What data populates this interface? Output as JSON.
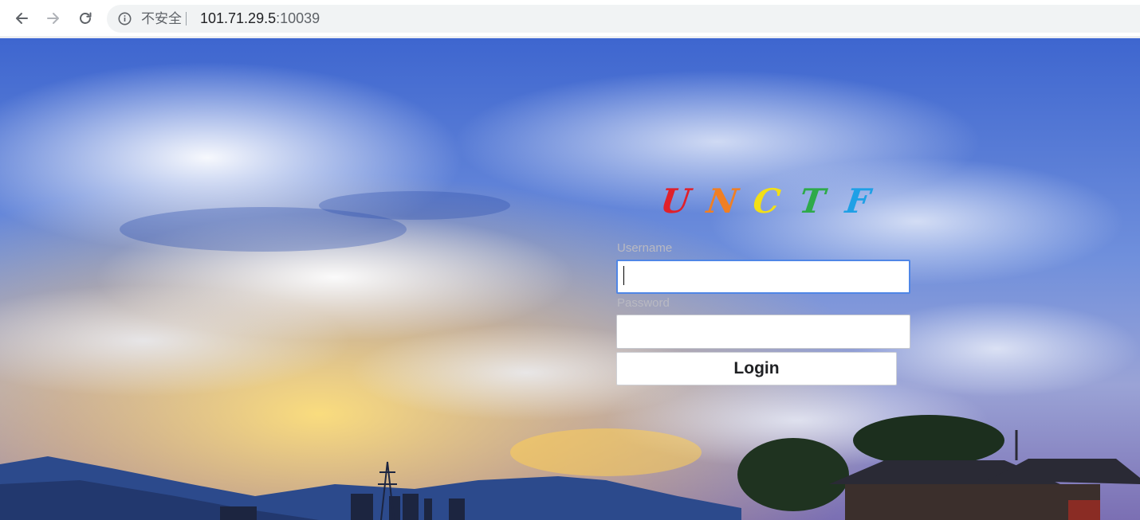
{
  "browser": {
    "security_label": "不安全",
    "url_host": "101.71.29.5",
    "url_port": ":10039",
    "icons": [
      "back-arrow-icon",
      "forward-arrow-icon",
      "reload-icon",
      "info-icon"
    ]
  },
  "page": {
    "brand_letters": [
      {
        "char": "U",
        "color": "#e0202a"
      },
      {
        "char": "N",
        "color": "#f07f24"
      },
      {
        "char": "C",
        "color": "#f2df16"
      },
      {
        "char": "T",
        "color": "#2eaa4a"
      },
      {
        "char": "F",
        "color": "#1ea0e6"
      }
    ],
    "username_label": "Username",
    "password_label": "Password",
    "username_value": "",
    "password_value": "",
    "login_label": "Login"
  },
  "colors": {
    "focus_border": "#4f86e6",
    "sky_top": "#4a6fd0",
    "sunset": "#f2c94c"
  }
}
